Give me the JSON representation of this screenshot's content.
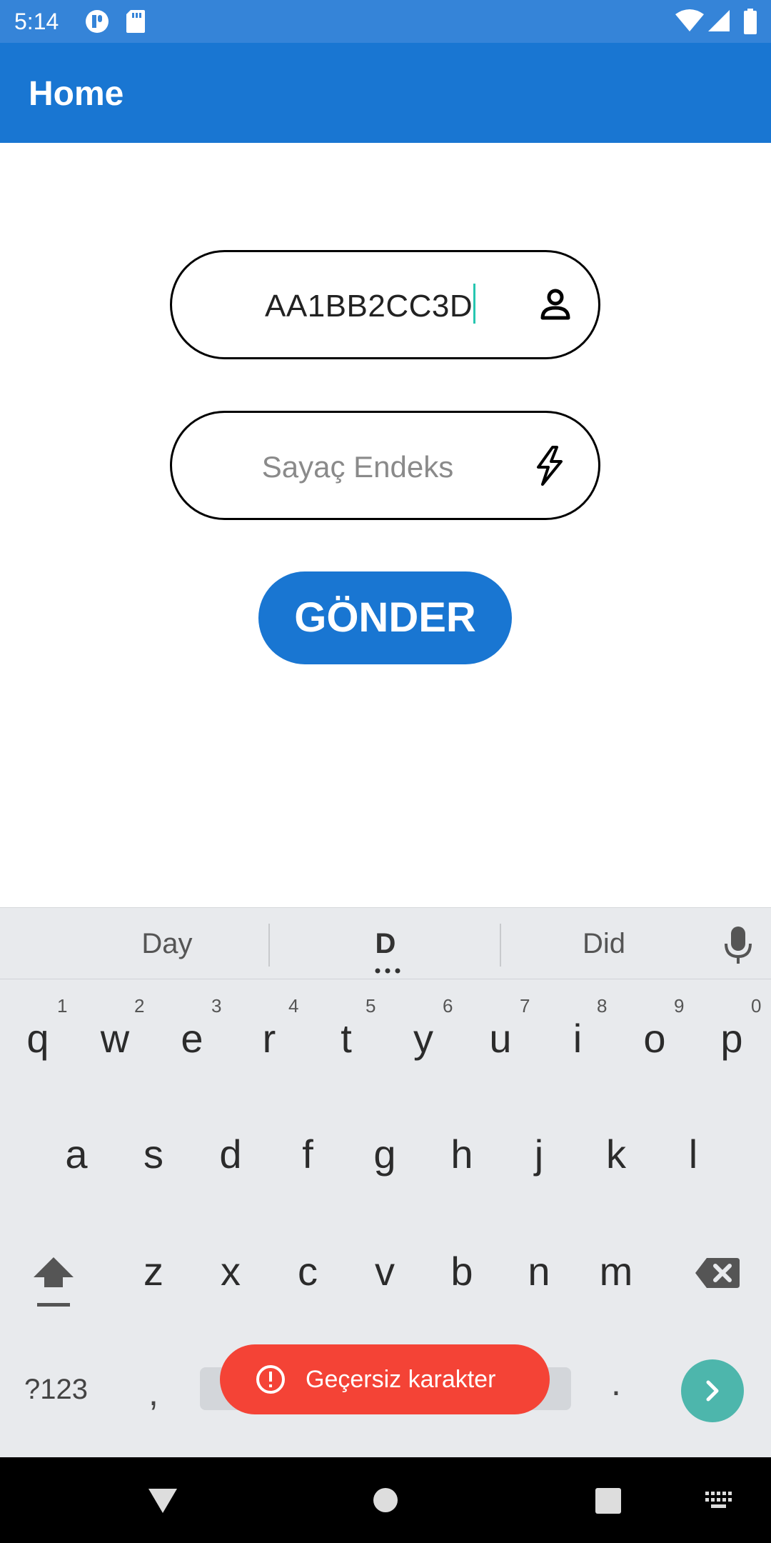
{
  "status_bar": {
    "time": "5:14",
    "icons": [
      "app-notification-icon",
      "sd-card-icon",
      "wifi-icon",
      "signal-icon",
      "battery-icon"
    ]
  },
  "app_bar": {
    "title": "Home"
  },
  "form": {
    "meter_id_value": "AA1BB2CC3D",
    "meter_id_icon": "person-icon",
    "index_placeholder": "Sayaç Endeks",
    "index_icon": "lightning-icon",
    "send_label": "GÖNDER"
  },
  "keyboard": {
    "suggestions": [
      "Day",
      "D",
      "Did"
    ],
    "row1": [
      "q",
      "w",
      "e",
      "r",
      "t",
      "y",
      "u",
      "i",
      "o",
      "p"
    ],
    "row1_numbers": [
      "1",
      "2",
      "3",
      "4",
      "5",
      "6",
      "7",
      "8",
      "9",
      "0"
    ],
    "row2": [
      "a",
      "s",
      "d",
      "f",
      "g",
      "h",
      "j",
      "k",
      "l"
    ],
    "row3": [
      "z",
      "x",
      "c",
      "v",
      "b",
      "n",
      "m"
    ],
    "symbols_label": "?123",
    "comma": ",",
    "period": "."
  },
  "toast": {
    "message": "Geçersiz karakter"
  },
  "colors": {
    "status_bar": "#3584D8",
    "app_bar": "#1976D2",
    "button": "#1976D2",
    "toast": "#F44336",
    "enter_key": "#4DB6AC",
    "caret": "#26C6B0"
  }
}
